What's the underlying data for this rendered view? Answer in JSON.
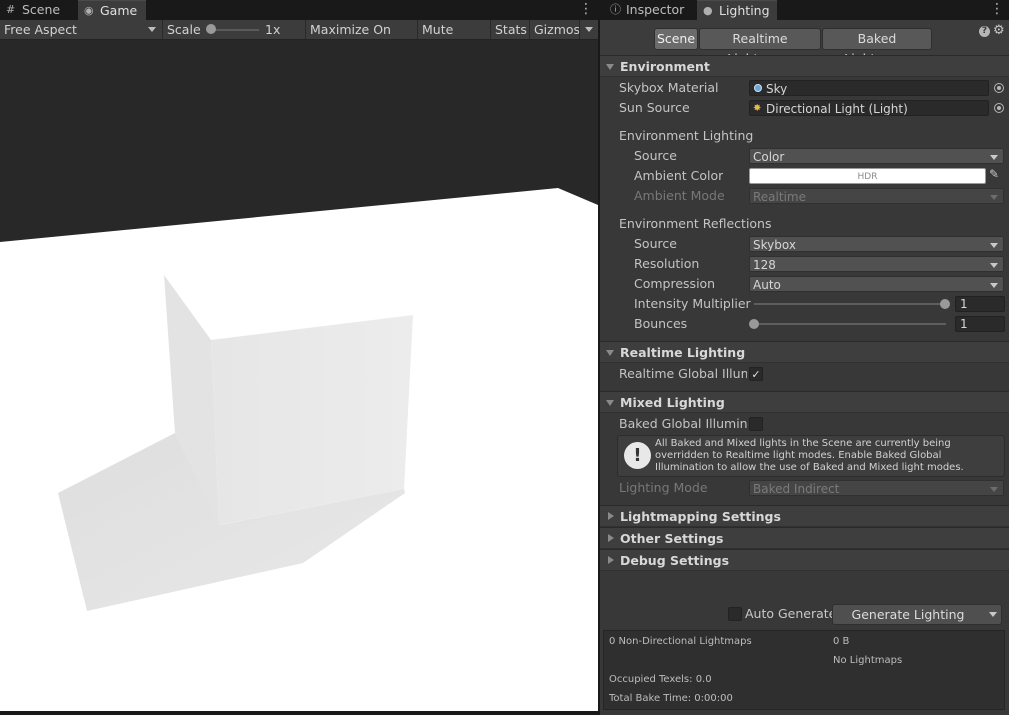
{
  "game_tabs": [
    {
      "label": "Scene",
      "icon": "grid-icon"
    },
    {
      "label": "Game",
      "icon": "gamepad-icon"
    }
  ],
  "game_toolbar": {
    "aspect": "Free Aspect",
    "scale_label": "Scale",
    "scale_value": "1x",
    "maximize": "Maximize On Play",
    "mute": "Mute Audio",
    "stats": "Stats",
    "gizmos": "Gizmos"
  },
  "light_tabs": [
    {
      "label": "Inspector",
      "icon": "info-icon"
    },
    {
      "label": "Lighting",
      "icon": "lightbulb-icon"
    }
  ],
  "mode_buttons": {
    "scene": "Scene",
    "realtime": "Realtime Lightmaps",
    "baked": "Baked Lightmaps"
  },
  "environment": {
    "header": "Environment",
    "skybox_label": "Skybox Material",
    "skybox_value": "Sky",
    "sun_label": "Sun Source",
    "sun_value": "Directional Light (Light)",
    "env_lighting": "Environment Lighting",
    "source_label": "Source",
    "source_value": "Color",
    "ambient_color_label": "Ambient Color",
    "ambient_color_text": "HDR",
    "ambient_color_hex": "#ffffff",
    "ambient_mode_label": "Ambient Mode",
    "ambient_mode_value": "Realtime",
    "env_reflections": "Environment Reflections",
    "refl_source_label": "Source",
    "refl_source_value": "Skybox",
    "resolution_label": "Resolution",
    "resolution_value": "128",
    "compression_label": "Compression",
    "compression_value": "Auto",
    "intensity_label": "Intensity Multiplier",
    "intensity_value": "1",
    "intensity_fraction": 1.0,
    "bounces_label": "Bounces",
    "bounces_value": "1",
    "bounces_fraction": 0.0
  },
  "realtime": {
    "header": "Realtime Lighting",
    "gi_label": "Realtime Global Illumin",
    "gi_checked": "✓"
  },
  "mixed": {
    "header": "Mixed Lighting",
    "baked_gi_label": "Baked Global Illuminati",
    "help_text": "All Baked and Mixed lights in the Scene are currently being overridden to Realtime light modes. Enable Baked Global Illumination to allow the use of Baked and Mixed light modes.",
    "mode_label": "Lighting Mode",
    "mode_value": "Baked Indirect"
  },
  "collapsed_sections": {
    "lightmapping": "Lightmapping Settings",
    "other": "Other Settings",
    "debug": "Debug Settings"
  },
  "bake": {
    "auto_generate": "Auto Generate",
    "generate": "Generate Lighting"
  },
  "stats": {
    "non_directional": "0 Non-Directional Lightmaps",
    "size": "0 B",
    "no_lightmaps": "No Lightmaps",
    "occupied": "Occupied Texels: 0.0",
    "bake_time": "Total Bake Time: 0:00:00"
  },
  "colors": {
    "panel": "#383838",
    "header": "#3e3e3e",
    "sky": "#282828",
    "ground": "#ffffff",
    "object": "#e4e4e4"
  }
}
